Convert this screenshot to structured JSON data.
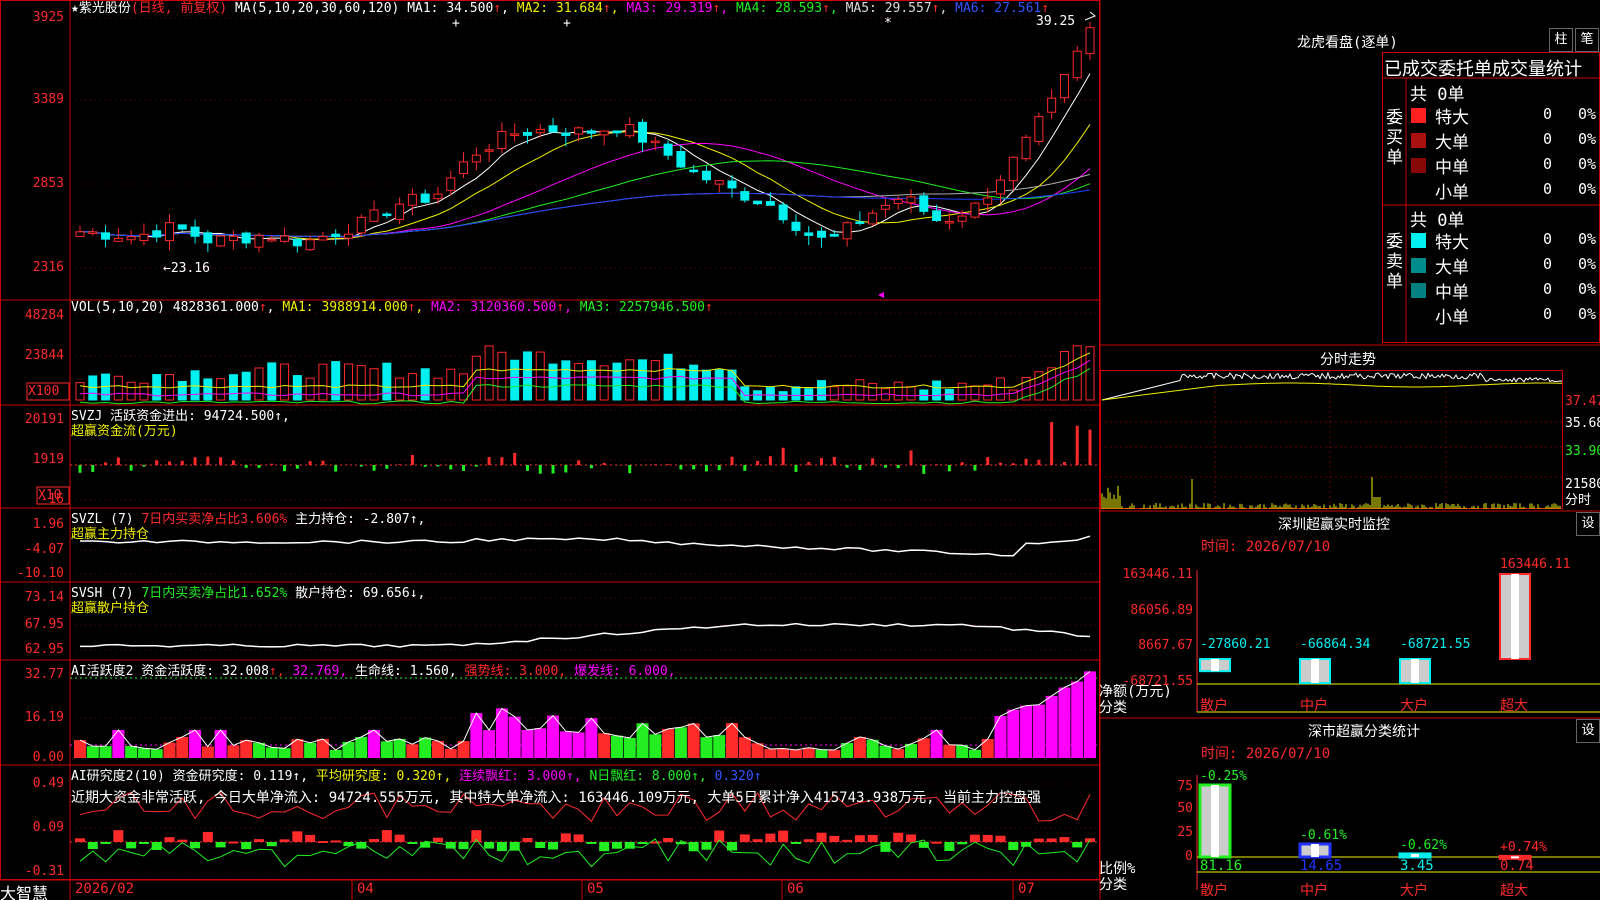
{
  "colors": {
    "up": "#ff2828",
    "down": "#00f0f0",
    "red": "#ff2a2a",
    "green": "#22ee22",
    "yellow": "#f0f000",
    "magenta": "#ff00ff",
    "cyan": "#00f0f0",
    "white": "#ffffff",
    "grid": "#880000",
    "blue": "#1e3cff",
    "axis": "#cc0000"
  },
  "main": {
    "star": "★",
    "stock": "紫光股份",
    "period": "(日线, 前复权)",
    "ma_label": "MA(5,10,20,30,60,120)",
    "ma": [
      {
        "name": "MA1:",
        "value": "34.500",
        "arrow": "↑"
      },
      {
        "name": "MA2:",
        "value": "31.684",
        "arrow": "↑"
      },
      {
        "name": "MA3:",
        "value": "29.319",
        "arrow": "↑"
      },
      {
        "name": "MA4:",
        "value": "28.593",
        "arrow": "↑"
      },
      {
        "name": "MA5:",
        "value": "29.557",
        "arrow": "↑"
      },
      {
        "name": "MA6:",
        "value": "27.561",
        "arrow": "↑"
      }
    ],
    "price_axis": [
      "3925",
      "3389",
      "2853",
      "2316"
    ],
    "high_note": "39.25",
    "low_note": "←23.16",
    "marks": [
      "+",
      "+",
      "*"
    ]
  },
  "vol": {
    "label": "VOL(5,10,20)",
    "value": "4828361.000",
    "arrow": "↑",
    "ma": [
      {
        "name": "MA1:",
        "value": "3988914.000",
        "arrow": "↑"
      },
      {
        "name": "MA2:",
        "value": "3120360.500",
        "arrow": "↑"
      },
      {
        "name": "MA3:",
        "value": "2257946.500",
        "arrow": "↑"
      }
    ],
    "axis": [
      "48284",
      "23844"
    ],
    "unit": "X100"
  },
  "svzj": {
    "line1": "SVZJ  活跃资金进出: 94724.500↑,",
    "line2": "超赢资金流(万元)",
    "axis": [
      "20191",
      "1919",
      "-16"
    ],
    "unit": "X10"
  },
  "svzl": {
    "prefix": "SVZL (7)",
    "highlight": "7日内买卖净占比3.606%",
    "rest": "主力持仓: -2.807↑,",
    "line2": "超赢主力持仓",
    "axis": [
      "1.96",
      "-4.07",
      "-10.10"
    ]
  },
  "svsh": {
    "prefix": "SVSH (7)",
    "highlight": "7日内买卖净占比1.652%",
    "rest": "散户持仓: 69.656↓,",
    "line2": "超赢散户持仓",
    "axis": [
      "73.14",
      "67.95",
      "62.95"
    ]
  },
  "ai1": {
    "label": "AI活跃度2 资金活跃度:",
    "v1": "32.008",
    "arrow1": "↑,",
    "v2": "32.769,",
    "life": "生命线: 1.560,",
    "strong": "强势线: 3.000,",
    "burst": "爆发线: 6.000,",
    "axis": [
      "32.77",
      "16.19",
      "0.00"
    ]
  },
  "ai2": {
    "label": "AI研究度2(10) 资金研究度: 0.119↑,",
    "avg": "平均研究度: 0.320↑,",
    "lian": "连续飘红: 3.000↑,",
    "nri": "N日飘红: 8.000↑,",
    "last": "0.320↑",
    "summary": "近期大资金非常活跃, 今日大单净流入: 94724.555万元, 其中特大单净流入: 163446.109万元, 大单5日累计净入415743.938万元, 当前主力控盘强",
    "axis": [
      "0.49",
      "0.09",
      "-0.31"
    ]
  },
  "xaxis": [
    "2026/02",
    "04",
    "05",
    "06",
    "07"
  ],
  "bottom_left": "大智慧",
  "right": {
    "lhb_title": "龙虎看盘(逐单)",
    "btn_zhu": "柱",
    "btn_bi": "笔",
    "stat_title": "已成交委托单成交量统计",
    "buy_label": "委买单",
    "sell_label": "委卖单",
    "buy_total": "共 0单",
    "sell_total": "共 0单",
    "rows": [
      {
        "name": "特大",
        "n": "0",
        "p": "0%"
      },
      {
        "name": "大单",
        "n": "0",
        "p": "0%"
      },
      {
        "name": "中单",
        "n": "0",
        "p": "0%"
      },
      {
        "name": "小单",
        "n": "0",
        "p": "0%"
      }
    ],
    "fenshi_title": "分时走势",
    "fenshi_axis": [
      "37.47",
      "35.68",
      "33.90"
    ],
    "fenshi_vol": "21580",
    "fenshi_vol_unit": "分时",
    "sz_title": "深圳超赢实时监控",
    "sz_time": "时间: 2026/07/10",
    "sz_axis": [
      "163446.11",
      "86056.89",
      "8667.67",
      "-68721.55"
    ],
    "sz_bars": [
      {
        "cat": "散户",
        "val": "-27860.21",
        "v": -27860.21
      },
      {
        "cat": "中户",
        "val": "-66864.34",
        "v": -66864.34
      },
      {
        "cat": "大户",
        "val": "-68721.55",
        "v": -68721.55
      },
      {
        "cat": "超大",
        "val": "163446.11",
        "v": 163446.11
      }
    ],
    "sz_ylabel": "净额(万元)",
    "sz_xlabel": "分类",
    "sf_title": "深市超赢分类统计",
    "sf_time": "时间: 2026/07/10",
    "sf_axis": [
      "75",
      "50",
      "25",
      "0"
    ],
    "sf_bars": [
      {
        "cat": "散户",
        "val": "81.16",
        "delta": "-0.25%",
        "v": 81.16
      },
      {
        "cat": "中户",
        "val": "14.65",
        "delta": "-0.61%",
        "v": 14.65
      },
      {
        "cat": "大户",
        "val": "3.45",
        "delta": "-0.62%",
        "v": 3.45
      },
      {
        "cat": "超大",
        "val": "0.74",
        "delta": "+0.74%",
        "v": 0.74
      }
    ],
    "sf_ylabel": "比例%",
    "sf_xlabel": "分类",
    "set_btn": "设"
  }
}
